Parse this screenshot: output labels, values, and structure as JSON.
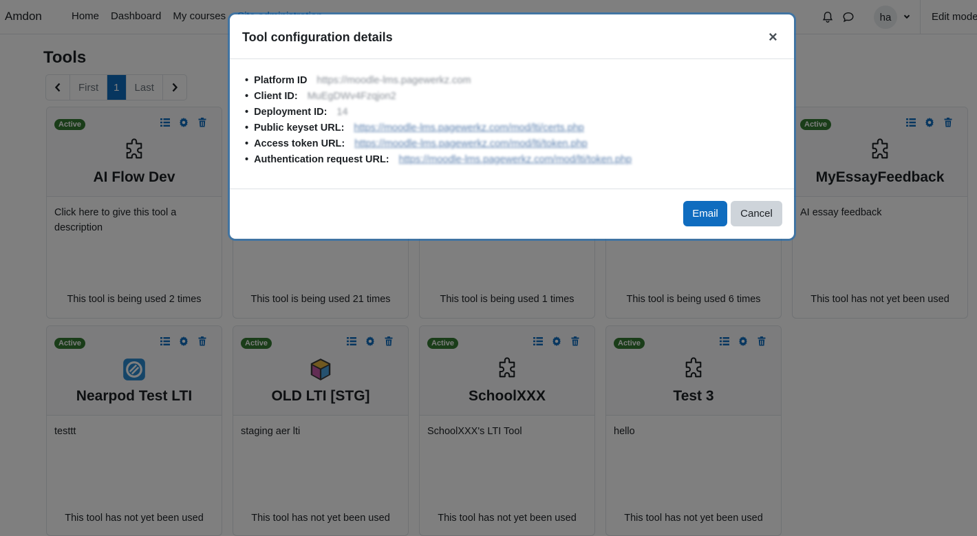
{
  "navbar": {
    "brand": "Amdon",
    "links": [
      "Home",
      "Dashboard",
      "My courses",
      "Site administration"
    ],
    "avatar_initials": "ha",
    "edit_mode": "Edit mode"
  },
  "page": {
    "title": "Tools",
    "pagination": {
      "first": "First",
      "current": "1",
      "last": "Last"
    }
  },
  "cards": [
    {
      "status": "Active",
      "name": "AI Flow Dev",
      "description": "Click here to give this tool a description",
      "usage": "This tool is being used 2 times",
      "icon": "puzzle-icon"
    },
    {
      "status": "Active",
      "name": "",
      "description": "",
      "usage": "This tool is being used 21 times",
      "icon": "puzzle-icon"
    },
    {
      "status": "Active",
      "name": "",
      "description": "",
      "usage": "This tool is being used 1 times",
      "icon": "puzzle-icon"
    },
    {
      "status": "Active",
      "name": "",
      "description": "",
      "usage": "This tool is being used 6 times",
      "icon": "puzzle-icon"
    },
    {
      "status": "Active",
      "name": "MyEssayFeedback",
      "description": "AI essay feedback",
      "usage": "This tool has not yet been used",
      "icon": "puzzle-icon"
    },
    {
      "status": "Active",
      "name": "Nearpod Test LTI",
      "description": "testtt",
      "usage": "This tool has not yet been used",
      "icon": "nearpod-logo-icon"
    },
    {
      "status": "Active",
      "name": "OLD LTI [STG]",
      "description": "staging aer lti",
      "usage": "This tool has not yet been used",
      "icon": "cube-logo-icon"
    },
    {
      "status": "Active",
      "name": "SchoolXXX",
      "description": "SchoolXXX's LTI Tool",
      "usage": "This tool has not yet been used",
      "icon": "puzzle-icon"
    },
    {
      "status": "Active",
      "name": "Test 3",
      "description": "hello",
      "usage": "This tool has not yet been used",
      "icon": "puzzle-icon"
    }
  ],
  "modal": {
    "title": "Tool configuration details",
    "close": "×",
    "details": [
      {
        "label": "Platform ID",
        "value": "https://moodle-lms.pagewerkz.com"
      },
      {
        "label": "Client ID:",
        "value": "MuEgDWv4Fzqjon2"
      },
      {
        "label": "Deployment ID:",
        "value": "14"
      },
      {
        "label": "Public keyset URL:",
        "value": "https://moodle-lms.pagewerkz.com/mod/lti/certs.php"
      },
      {
        "label": "Access token URL:",
        "value": "https://moodle-lms.pagewerkz.com/mod/lti/token.php"
      },
      {
        "label": "Authentication request URL:",
        "value": "https://moodle-lms.pagewerkz.com/mod/lti/token.php"
      }
    ],
    "email_label": "Email",
    "cancel_label": "Cancel"
  },
  "colors": {
    "brand": "#0f6cbf",
    "badge": "#357a32",
    "backdrop": "rgba(0,0,0,0.5)"
  }
}
